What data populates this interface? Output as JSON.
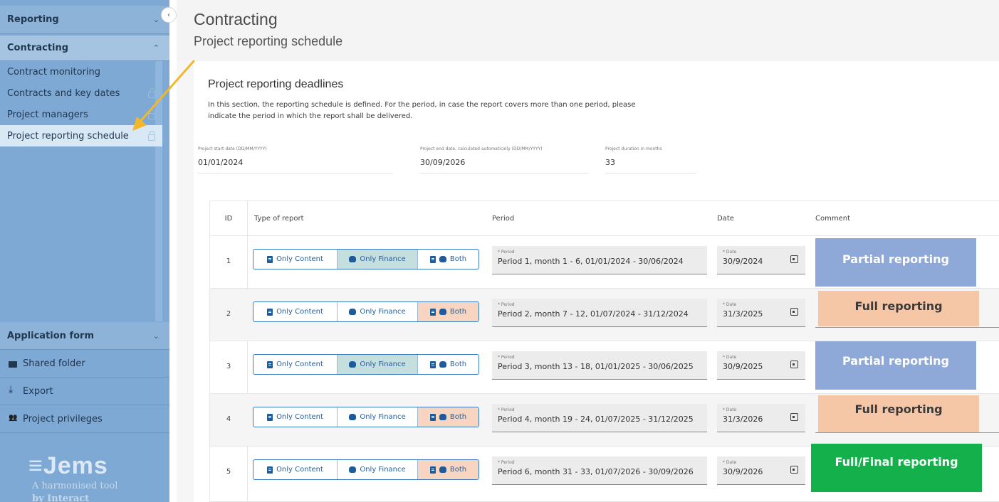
{
  "sidebar": {
    "reporting": "Reporting",
    "contracting": "Contracting",
    "items": [
      {
        "label": "Contract monitoring"
      },
      {
        "label": "Contracts and key dates"
      },
      {
        "label": "Project managers"
      },
      {
        "label": "Project reporting schedule"
      }
    ],
    "application_form": "Application form",
    "shared_folder": "Shared folder",
    "export": "Export",
    "project_privileges": "Project privileges",
    "logo": "≡Jems",
    "logo_sub": "A harmonised tool",
    "logo_sub2": "by Interact"
  },
  "header": {
    "title": "Contracting",
    "subtitle": "Project reporting schedule"
  },
  "section": {
    "title": "Project reporting deadlines",
    "description_line1": "In this section, the reporting schedule is defined. For the period, in case the report covers more than one period, please",
    "description_line2": "indicate the period in which the report shall be delivered."
  },
  "fields": {
    "start_label": "Project start date (DD/MM/YYYY)",
    "start_value": "01/01/2024",
    "end_label": "Project end date, calculated automatically (DD/MM/YYYY)",
    "end_value": "30/09/2026",
    "duration_label": "Project duration in months",
    "duration_value": "33"
  },
  "table": {
    "headers": {
      "id": "ID",
      "type": "Type of report",
      "period": "Period",
      "date": "Date",
      "comment": "Comment"
    },
    "option_content": "Only Content",
    "option_finance": "Only Finance",
    "option_both": "Both",
    "period_label": "* Period",
    "date_label": "* Date",
    "rows": [
      {
        "id": "1",
        "selected": "finance",
        "period": "Period 1, month 1 - 6, 01/01/2024 - 30/06/2024",
        "date": "30/9/2024",
        "tag": "Partial reporting"
      },
      {
        "id": "2",
        "selected": "both",
        "period": "Period 2, month 7 - 12, 01/07/2024 - 31/12/2024",
        "date": "31/3/2025",
        "tag": "Full reporting"
      },
      {
        "id": "3",
        "selected": "finance",
        "period": "Period 3, month 13 - 18, 01/01/2025 - 30/06/2025",
        "date": "30/9/2025",
        "tag": "Partial reporting"
      },
      {
        "id": "4",
        "selected": "both",
        "period": "Period 4, month 19 - 24, 01/07/2025 - 31/12/2025",
        "date": "31/3/2026",
        "tag": "Full reporting"
      },
      {
        "id": "5",
        "selected": "both",
        "period": "Period 6, month 31 - 33, 01/07/2026 - 30/09/2026",
        "date": "30/9/2026",
        "tag": "Full/Final reporting"
      }
    ]
  },
  "colors": {
    "sidebar": "#7ea9d4",
    "partial": "#8ea8d8",
    "full": "#f5c7a6",
    "final": "#13b04b",
    "finance_selected": "#c5dede",
    "both_selected": "#f7d5c0",
    "arrow": "#f2b829"
  }
}
